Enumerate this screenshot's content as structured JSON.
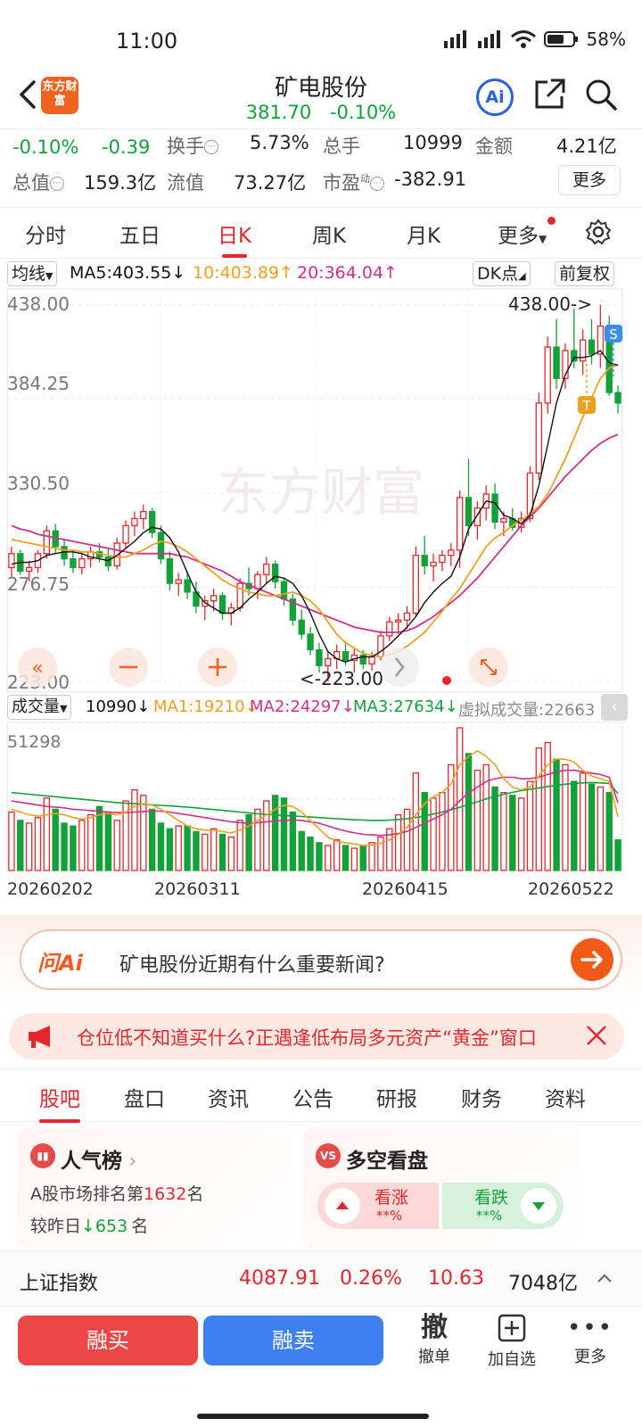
{
  "status_bar": {
    "time": "11:00",
    "battery": "58%"
  },
  "header": {
    "logo_text": "东方财富",
    "stock_name": "矿电股份",
    "price": "381.70",
    "change_pct": "-0.10%",
    "ai_label": "Ai"
  },
  "quote": {
    "change_pct": "-0.10%",
    "change_amt": "-0.39",
    "turnover_label": "换手",
    "turnover": "5.73%",
    "total_hands_label": "总手",
    "total_hands": "10999",
    "amount_label": "金额",
    "amount": "4.21亿",
    "total_value_label": "总值",
    "total_value": "159.3亿",
    "float_value_label": "流值",
    "float_value": "73.27亿",
    "pe_label": "市盈",
    "pe_super": "动",
    "pe": "-382.91",
    "more": "更多"
  },
  "period_tabs": [
    "分时",
    "五日",
    "日K",
    "周K",
    "月K",
    "更多"
  ],
  "active_period": 2,
  "ma_legend": {
    "selector": "均线",
    "ma5": "MA5:403.55↓",
    "ma10": "10:403.89↑",
    "ma20": "20:364.04↑",
    "dk": "DK点",
    "adjust": "前复权"
  },
  "kchart": {
    "price_labels": [
      "438.00",
      "384.25",
      "330.50",
      "276.75",
      "223.00"
    ],
    "high_marker": "438.00->",
    "low_marker": "<-223.00",
    "watermark": "东方财富",
    "s_marker": "S",
    "t_marker": "T"
  },
  "vol_legend": {
    "selector": "成交量",
    "vol": "10990↓",
    "ma1": "MA1:19210↓",
    "ma2": "MA2:24297↓",
    "ma3": "MA3:27634↓",
    "virtual": "虚拟成交量:22663"
  },
  "volchart": {
    "max_label": "51298"
  },
  "dates": [
    "20260202",
    "20260311",
    "20260415",
    "20260522"
  ],
  "ask_ai": {
    "logo": "问Ai",
    "question": "矿电股份近期有什么重要新闻?"
  },
  "banner": {
    "text": "仓位低不知道买什么?正遇逢低布局多元资产“黄金”窗口"
  },
  "content_tabs": [
    "股吧",
    "盘口",
    "资讯",
    "公告",
    "研报",
    "财务",
    "资料"
  ],
  "active_content_tab": 0,
  "rank_card": {
    "title": "人气榜",
    "line1_prefix": "A股市场排名第",
    "rank": "1632",
    "line1_suffix": "名",
    "line2_prefix": "较昨日",
    "delta": "↓653",
    "line2_suffix": "名"
  },
  "vote_card": {
    "title": "多空看盘",
    "up_label": "看涨",
    "up_value": "**%",
    "down_label": "看跌",
    "down_value": "**%"
  },
  "index_bar": {
    "name": "上证指数",
    "value": "4087.91",
    "pct": "0.26%",
    "change": "10.63",
    "volume": "7048亿"
  },
  "bottom_bar": {
    "buy": "融买",
    "sell": "融卖",
    "cancel_glyph": "撤",
    "cancel": "撤单",
    "add": "加自选",
    "more": "更多"
  },
  "colors": {
    "up": "#e5262d",
    "down": "#12a239",
    "ma5": "#111111",
    "ma10": "#f0a020",
    "ma20": "#d0308a",
    "accent": "#f25a18"
  },
  "chart_data": {
    "type": "candlestick",
    "price_axis": [
      223.0,
      438.0
    ],
    "price_ticks": [
      438.0,
      384.25,
      330.5,
      276.75,
      223.0
    ],
    "high": 438.0,
    "low": 223.0,
    "ohlc": [
      [
        288,
        300,
        282,
        296
      ],
      [
        296,
        298,
        284,
        286
      ],
      [
        286,
        292,
        280,
        288
      ],
      [
        288,
        298,
        285,
        296
      ],
      [
        296,
        312,
        293,
        309
      ],
      [
        309,
        313,
        296,
        300
      ],
      [
        300,
        304,
        289,
        293
      ],
      [
        293,
        298,
        285,
        288
      ],
      [
        288,
        296,
        284,
        293
      ],
      [
        293,
        300,
        288,
        297
      ],
      [
        297,
        302,
        291,
        294
      ],
      [
        294,
        299,
        286,
        289
      ],
      [
        289,
        305,
        287,
        302
      ],
      [
        302,
        315,
        299,
        312
      ],
      [
        312,
        320,
        306,
        316
      ],
      [
        316,
        324,
        310,
        320
      ],
      [
        320,
        322,
        305,
        308
      ],
      [
        308,
        312,
        290,
        293
      ],
      [
        293,
        297,
        275,
        279
      ],
      [
        279,
        285,
        272,
        281
      ],
      [
        281,
        286,
        270,
        274
      ],
      [
        274,
        280,
        262,
        266
      ],
      [
        266,
        272,
        258,
        269
      ],
      [
        269,
        276,
        263,
        272
      ],
      [
        272,
        274,
        258,
        262
      ],
      [
        262,
        268,
        255,
        265
      ],
      [
        265,
        282,
        263,
        279
      ],
      [
        279,
        288,
        272,
        276
      ],
      [
        276,
        286,
        270,
        284
      ],
      [
        284,
        294,
        279,
        290
      ],
      [
        290,
        292,
        276,
        280
      ],
      [
        280,
        282,
        266,
        270
      ],
      [
        270,
        273,
        255,
        258
      ],
      [
        258,
        264,
        247,
        250
      ],
      [
        250,
        254,
        238,
        241
      ],
      [
        241,
        245,
        228,
        232
      ],
      [
        232,
        240,
        223,
        236
      ],
      [
        236,
        244,
        230,
        240
      ],
      [
        240,
        246,
        232,
        235
      ],
      [
        235,
        242,
        228,
        238
      ],
      [
        238,
        241,
        230,
        233
      ],
      [
        233,
        240,
        229,
        237
      ],
      [
        237,
        252,
        235,
        249
      ],
      [
        249,
        260,
        246,
        257
      ],
      [
        257,
        262,
        250,
        258
      ],
      [
        258,
        266,
        253,
        262
      ],
      [
        262,
        300,
        260,
        295
      ],
      [
        295,
        306,
        284,
        289
      ],
      [
        289,
        296,
        280,
        291
      ],
      [
        291,
        298,
        286,
        295
      ],
      [
        295,
        302,
        289,
        298
      ],
      [
        298,
        332,
        288,
        328
      ],
      [
        328,
        350,
        306,
        312
      ],
      [
        312,
        326,
        304,
        322
      ],
      [
        322,
        335,
        315,
        330
      ],
      [
        330,
        336,
        310,
        314
      ],
      [
        314,
        320,
        306,
        316
      ],
      [
        316,
        322,
        309,
        311
      ],
      [
        311,
        320,
        308,
        316
      ],
      [
        316,
        346,
        314,
        342
      ],
      [
        342,
        388,
        338,
        382
      ],
      [
        382,
        420,
        376,
        414
      ],
      [
        414,
        430,
        390,
        396
      ],
      [
        396,
        416,
        390,
        412
      ],
      [
        412,
        436,
        402,
        406
      ],
      [
        406,
        424,
        398,
        418
      ],
      [
        418,
        430,
        404,
        410
      ],
      [
        410,
        438,
        402,
        426
      ],
      [
        426,
        432,
        386,
        388
      ],
      [
        388,
        392,
        376,
        382
      ]
    ],
    "volume_axis_max": 51298,
    "volume": [
      21000,
      18000,
      17000,
      19000,
      26000,
      22000,
      17000,
      16000,
      18000,
      20000,
      23000,
      21000,
      18000,
      25000,
      29000,
      27000,
      22000,
      17000,
      15000,
      16000,
      16000,
      14000,
      13000,
      15000,
      13000,
      12000,
      18000,
      20000,
      22000,
      25000,
      27000,
      26000,
      21000,
      14000,
      12000,
      10000,
      9000,
      11000,
      9000,
      8000,
      9000,
      10000,
      12000,
      15000,
      20000,
      22000,
      35000,
      28000,
      26000,
      28000,
      38000,
      51298,
      42000,
      36000,
      38000,
      30000,
      28000,
      27000,
      26000,
      32000,
      44000,
      46000,
      40000,
      38000,
      32000,
      35000,
      31000,
      30000,
      28000,
      10990
    ],
    "volume_up": [
      true,
      false,
      true,
      true,
      true,
      false,
      false,
      false,
      true,
      true,
      false,
      false,
      true,
      true,
      true,
      true,
      false,
      false,
      false,
      true,
      false,
      false,
      true,
      true,
      false,
      true,
      true,
      false,
      true,
      true,
      false,
      false,
      false,
      false,
      false,
      false,
      true,
      true,
      false,
      true,
      false,
      true,
      true,
      true,
      true,
      true,
      true,
      false,
      true,
      true,
      true,
      true,
      false,
      true,
      true,
      false,
      true,
      false,
      true,
      true,
      true,
      true,
      false,
      true,
      false,
      true,
      false,
      true,
      false,
      false
    ],
    "ma5": [
      290,
      291,
      291,
      292,
      295,
      296,
      297,
      297,
      296,
      294,
      293,
      292,
      295,
      299,
      303,
      308,
      311,
      310,
      305,
      297,
      285,
      274,
      268,
      265,
      262,
      262,
      265,
      270,
      274,
      279,
      283,
      282,
      279,
      272,
      262,
      250,
      240,
      236,
      234,
      236,
      237,
      237,
      240,
      244,
      249,
      254,
      260,
      268,
      274,
      279,
      283,
      294,
      310,
      318,
      326,
      325,
      318,
      316,
      313,
      318,
      335,
      358,
      382,
      398,
      408,
      408,
      409,
      412,
      405,
      403.55
    ],
    "ma10": [
      304,
      303,
      302,
      301,
      300,
      299,
      298,
      298,
      297,
      297,
      296,
      295,
      294,
      294,
      296,
      298,
      301,
      303,
      302,
      300,
      297,
      293,
      289,
      285,
      281,
      278,
      276,
      274,
      273,
      272,
      272,
      273,
      274,
      272,
      269,
      264,
      257,
      250,
      245,
      242,
      239,
      238,
      237,
      238,
      240,
      243,
      247,
      251,
      257,
      263,
      270,
      276,
      284,
      292,
      300,
      305,
      308,
      312,
      315,
      319,
      323,
      330,
      340,
      350,
      362,
      374,
      385,
      396,
      402,
      403.89
    ],
    "ma20": [
      312,
      310,
      309,
      307,
      306,
      305,
      304,
      303,
      302,
      301,
      300,
      299,
      298,
      297,
      296,
      296,
      296,
      296,
      296,
      295,
      294,
      292,
      290,
      288,
      286,
      283,
      280,
      278,
      276,
      274,
      272,
      270,
      268,
      266,
      264,
      262,
      260,
      258,
      256,
      254,
      253,
      252,
      251,
      251,
      251,
      252,
      254,
      257,
      260,
      264,
      268,
      272,
      277,
      282,
      288,
      294,
      300,
      306,
      312,
      317,
      322,
      328,
      334,
      340,
      345,
      350,
      355,
      359,
      362,
      364.04
    ],
    "vol_ma1": [
      22000,
      21000,
      20000,
      19500,
      20000,
      20500,
      20000,
      19000,
      18500,
      19000,
      20000,
      20500,
      20000,
      21000,
      23000,
      24000,
      23500,
      22000,
      20000,
      18000,
      16000,
      15000,
      14500,
      14500,
      14000,
      13500,
      14500,
      16000,
      18000,
      20000,
      22000,
      23500,
      23000,
      21000,
      18000,
      15000,
      12000,
      10500,
      10000,
      9500,
      9000,
      9200,
      9800,
      11000,
      13000,
      15500,
      20000,
      24000,
      26500,
      28000,
      31000,
      38000,
      41000,
      43000,
      41000,
      38000,
      33000,
      30000,
      29000,
      30000,
      34000,
      38000,
      40000,
      40000,
      39000,
      36000,
      34000,
      33000,
      32000,
      19210
    ],
    "vol_ma2": [
      25000,
      24500,
      24000,
      23500,
      23000,
      22800,
      22500,
      22000,
      21800,
      21500,
      21300,
      21000,
      20800,
      20800,
      21000,
      21200,
      21400,
      21300,
      21000,
      20500,
      20000,
      19500,
      19000,
      18500,
      18000,
      17500,
      17200,
      17000,
      17200,
      17500,
      17800,
      18000,
      18200,
      18000,
      17500,
      17000,
      16000,
      15000,
      14200,
      13500,
      13000,
      12800,
      12600,
      12800,
      13300,
      14000,
      15500,
      17000,
      18500,
      20000,
      22000,
      25000,
      28000,
      30000,
      32000,
      33000,
      33500,
      33500,
      33000,
      33000,
      33500,
      34500,
      35500,
      36000,
      36000,
      35500,
      35000,
      34500,
      33500,
      24297
    ],
    "vol_ma3": [
      28000,
      27700,
      27400,
      27100,
      26800,
      26500,
      26200,
      25900,
      25600,
      25300,
      25000,
      24700,
      24400,
      24200,
      24000,
      23800,
      23600,
      23400,
      23200,
      23000,
      22800,
      22500,
      22200,
      21900,
      21600,
      21300,
      21000,
      20700,
      20400,
      20200,
      20000,
      19800,
      19600,
      19400,
      19200,
      19000,
      18800,
      18600,
      18400,
      18200,
      18100,
      18000,
      18000,
      18100,
      18300,
      18600,
      19000,
      19600,
      20300,
      21000,
      21800,
      22700,
      23700,
      24700,
      25700,
      26600,
      27400,
      28100,
      28700,
      29200,
      29700,
      30200,
      30600,
      31000,
      31300,
      31500,
      31600,
      31500,
      31300,
      27634
    ]
  }
}
